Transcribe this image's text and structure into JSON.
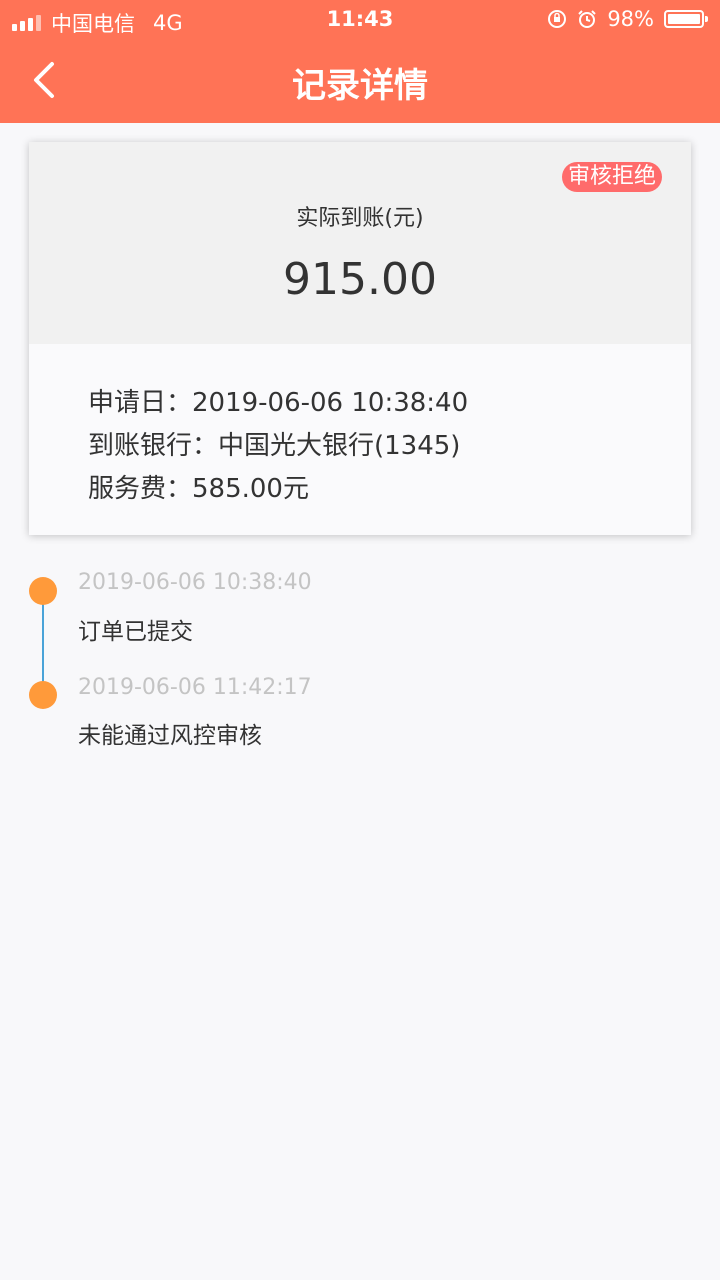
{
  "status_bar": {
    "carrier": "中国电信",
    "network": "4G",
    "time": "11:43",
    "battery": "98%"
  },
  "nav": {
    "title": "记录详情"
  },
  "card": {
    "badge": "审核拒绝",
    "amount_label": "实际到账(元)",
    "amount": "915.00",
    "apply_date": "申请日：2019-06-06 10:38:40",
    "bank": "到账银行：中国光大银行(1345)",
    "service_fee": "服务费：585.00元"
  },
  "timeline": [
    {
      "time": "2019-06-06 10:38:40",
      "text": "订单已提交"
    },
    {
      "time": "2019-06-06 11:42:17",
      "text": "未能通过风控审核"
    }
  ],
  "colors": {
    "header": "#ff7356",
    "badge": "#ff6b6b",
    "timeline_dot": "#ff9a3a",
    "timeline_line": "#4aa3d8"
  }
}
